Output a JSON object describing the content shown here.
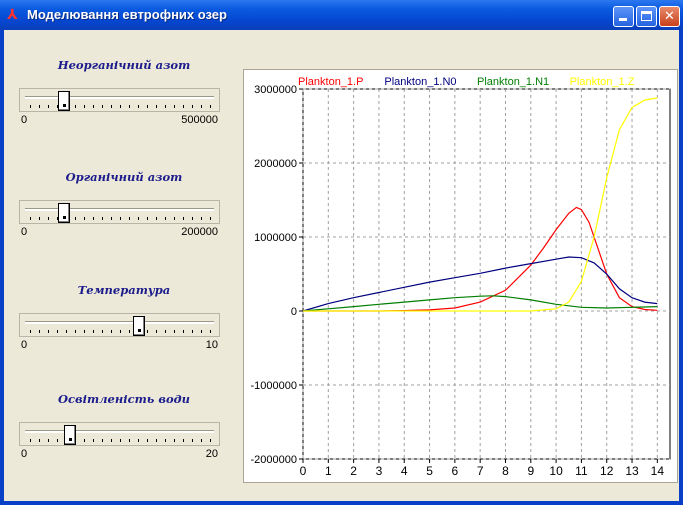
{
  "window": {
    "title": "Моделювання евтрофних озер",
    "minimize_label": "_",
    "maximize_label": "□",
    "close_label": "✕"
  },
  "sliders": [
    {
      "id": "inorganic-nitrogen",
      "title": "Неорганічний азот",
      "min_label": "0",
      "max_label": "500000",
      "value_fraction": 0.19
    },
    {
      "id": "organic-nitrogen",
      "title": "Органічний азот",
      "min_label": "0",
      "max_label": "200000",
      "value_fraction": 0.19
    },
    {
      "id": "temperature",
      "title": "Температура",
      "min_label": "0",
      "max_label": "10",
      "value_fraction": 0.6
    },
    {
      "id": "water-clarity",
      "title": "Освітленість води",
      "min_label": "0",
      "max_label": "20",
      "value_fraction": 0.22
    }
  ],
  "chart_data": {
    "type": "line",
    "title": "",
    "xlabel": "",
    "ylabel": "",
    "xlim": [
      0,
      14.5
    ],
    "ylim": [
      -2000000,
      3000000
    ],
    "x_ticks": [
      0,
      1,
      2,
      3,
      4,
      5,
      6,
      7,
      8,
      9,
      10,
      11,
      12,
      13,
      14
    ],
    "y_ticks": [
      3000000,
      2000000,
      1000000,
      0,
      -1000000,
      -2000000
    ],
    "y_tick_labels": [
      "3000000",
      "2000000",
      "1000000",
      "0",
      "-1000000",
      "-2000000"
    ],
    "grid": true,
    "legend_position": "top",
    "series": [
      {
        "name": "Plankton_1.P",
        "color": "#ff0000",
        "x": [
          0,
          1,
          2,
          3,
          4,
          5,
          6,
          7,
          8,
          9,
          9.5,
          10,
          10.5,
          10.8,
          11,
          11.3,
          11.6,
          12,
          12.5,
          13,
          13.5,
          14
        ],
        "y": [
          0,
          0,
          0,
          0,
          5000,
          15000,
          40000,
          120000,
          280000,
          620000,
          850000,
          1100000,
          1320000,
          1400000,
          1370000,
          1200000,
          900000,
          500000,
          180000,
          60000,
          20000,
          10000
        ]
      },
      {
        "name": "Plankton_1.N0",
        "color": "#00007f",
        "x": [
          0,
          1,
          2,
          3,
          4,
          5,
          6,
          7,
          8,
          9,
          10,
          10.5,
          11,
          11.5,
          12,
          12.5,
          13,
          13.5,
          14
        ],
        "y": [
          0,
          100000,
          180000,
          250000,
          320000,
          390000,
          450000,
          510000,
          580000,
          640000,
          700000,
          730000,
          720000,
          650000,
          500000,
          300000,
          180000,
          120000,
          100000
        ]
      },
      {
        "name": "Plankton_1.N1",
        "color": "#007f00",
        "x": [
          0,
          1,
          2,
          3,
          4,
          5,
          6,
          7,
          7.5,
          8,
          9,
          10,
          10.5,
          11,
          12,
          13,
          14
        ],
        "y": [
          0,
          30000,
          60000,
          90000,
          120000,
          150000,
          180000,
          200000,
          205000,
          195000,
          150000,
          90000,
          70000,
          50000,
          40000,
          50000,
          60000
        ]
      },
      {
        "name": "Plankton_1.Z",
        "color": "#ffff00",
        "x": [
          0,
          2,
          4,
          6,
          8,
          9,
          10,
          10.5,
          11,
          11.5,
          12,
          12.5,
          13,
          13.5,
          14
        ],
        "y": [
          0,
          0,
          0,
          0,
          0,
          0,
          30000,
          120000,
          400000,
          1000000,
          1800000,
          2450000,
          2750000,
          2850000,
          2880000
        ]
      }
    ]
  }
}
